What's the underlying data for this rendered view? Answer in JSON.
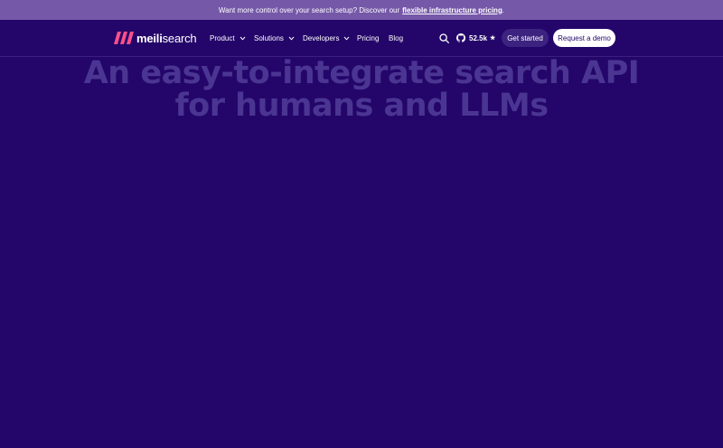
{
  "banner": {
    "text": "Want more control over your search setup? Discover our",
    "link": "flexible infrastructure pricing",
    "suffix": "."
  },
  "brand": {
    "part1": "meili",
    "part2": "search",
    "accent": "#ff4f8b"
  },
  "nav": {
    "items": [
      {
        "label": "Product"
      },
      {
        "label": "Solutions"
      },
      {
        "label": "Developers"
      },
      {
        "label": "Pricing"
      },
      {
        "label": "Blog"
      }
    ],
    "github_stars": "52.5k",
    "star_glyph": "★",
    "get_started": "Get started",
    "request_demo": "Request a demo"
  },
  "hero": {
    "line1": "An easy-to-integrate search API",
    "line2": "for humans and LLMs"
  },
  "colors": {
    "background": "#24066a",
    "banner": "#7558a8",
    "hero_text": "#4b3592"
  }
}
